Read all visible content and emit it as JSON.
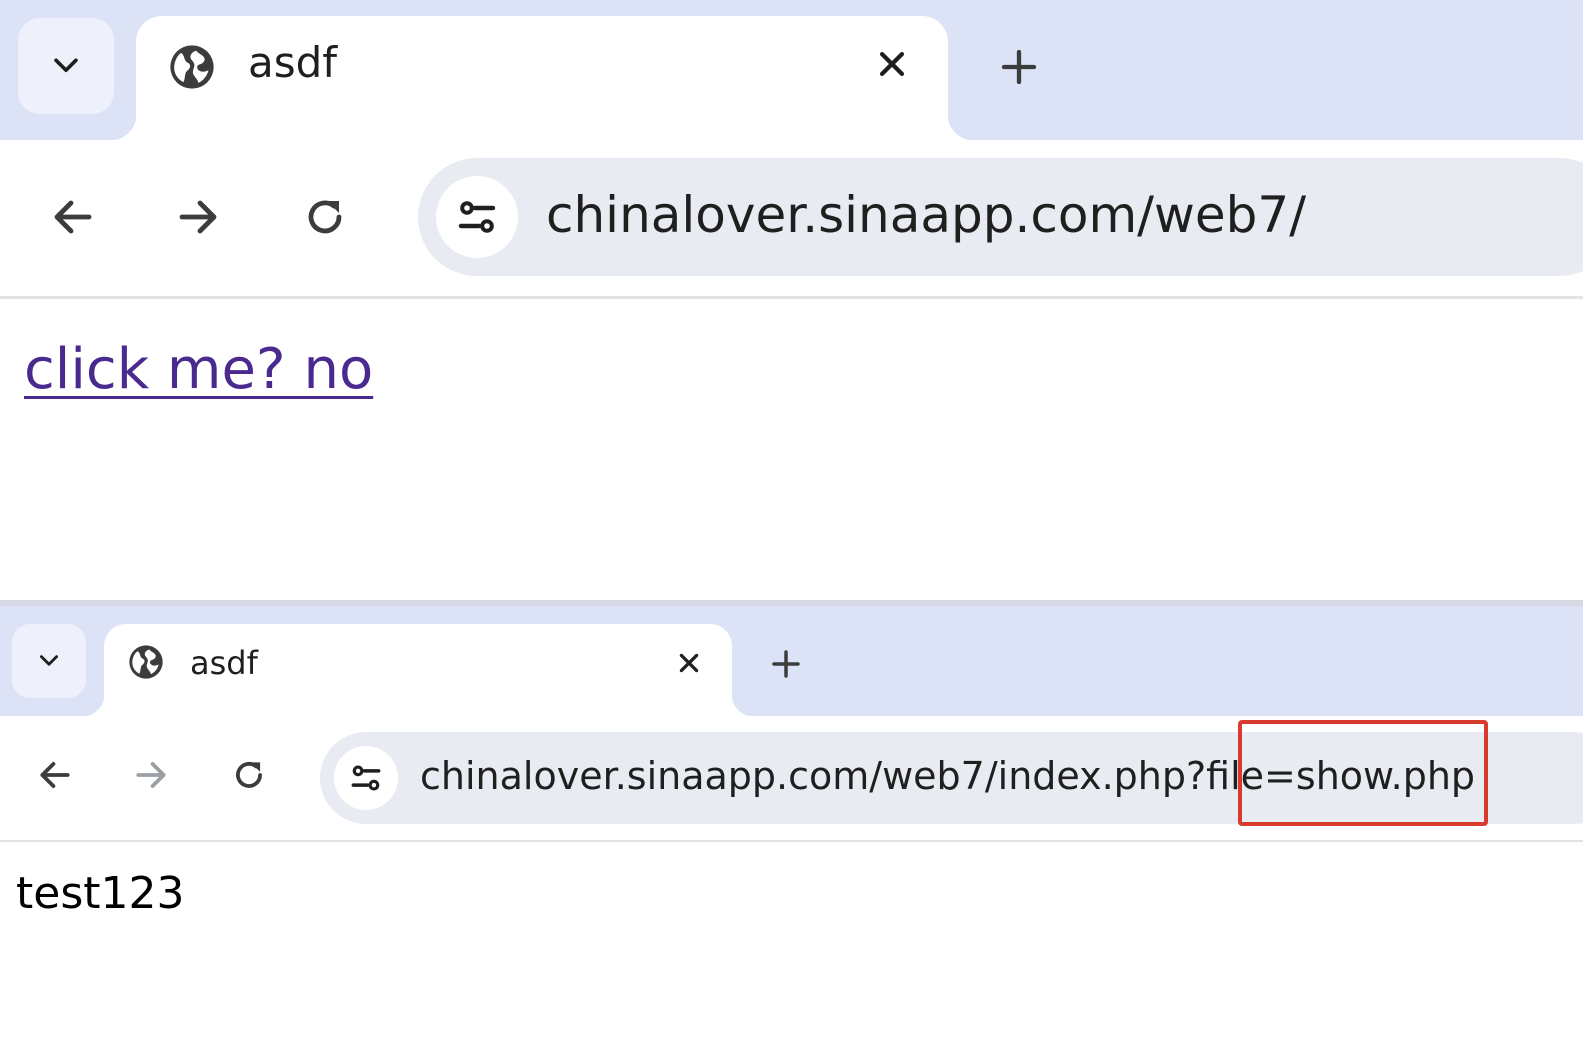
{
  "colors": {
    "tabstrip_bg": "#dde3f7",
    "omnibox_bg": "#e9ebf2",
    "link_visited": "#4b2a8f",
    "highlight_border": "#d93a2e",
    "forward_disabled": "#9aa0a6"
  },
  "windows": [
    {
      "tab": {
        "title": "asdf",
        "favicon": "globe-icon"
      },
      "toolbar": {
        "back_enabled": true,
        "forward_enabled": true,
        "url": "chinalover.sinaapp.com/web7/"
      },
      "page": {
        "link_text": "click me? no"
      }
    },
    {
      "tab": {
        "title": "asdf",
        "favicon": "globe-icon"
      },
      "toolbar": {
        "back_enabled": true,
        "forward_enabled": false,
        "url": "chinalover.sinaapp.com/web7/index.php?file=show.php"
      },
      "page": {
        "text": "test123"
      },
      "annotation": {
        "highlighted_segment": "show.php"
      }
    }
  ]
}
